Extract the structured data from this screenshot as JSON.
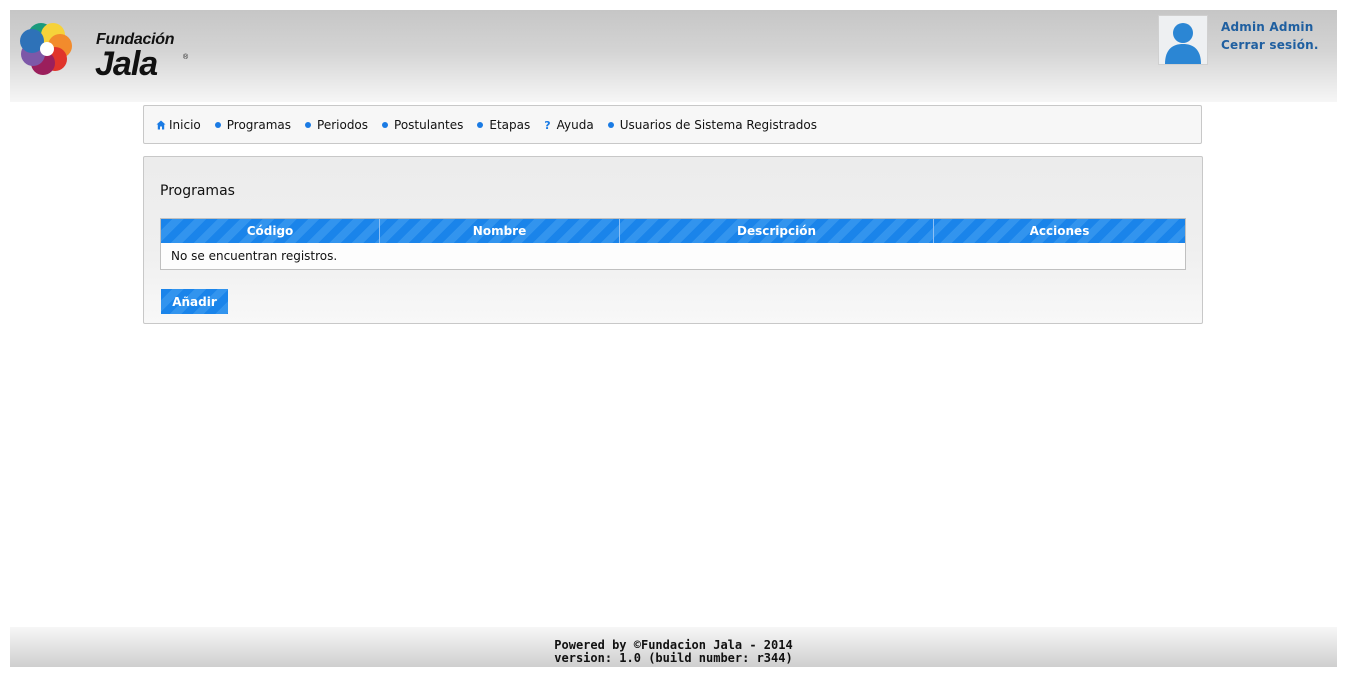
{
  "header": {
    "logo_text_top": "Fundación",
    "logo_text_main": "Jala",
    "logo_reg": "®",
    "user_name": "Admin Admin",
    "logout_label": "Cerrar sesión."
  },
  "nav": {
    "items": [
      {
        "label": "Inicio",
        "icon": "home-icon"
      },
      {
        "label": "Programas",
        "icon": "bullet-icon"
      },
      {
        "label": "Periodos",
        "icon": "bullet-icon"
      },
      {
        "label": "Postulantes",
        "icon": "bullet-icon"
      },
      {
        "label": "Etapas",
        "icon": "bullet-icon"
      },
      {
        "label": "Ayuda",
        "icon": "help-icon"
      },
      {
        "label": "Usuarios de Sistema Registrados",
        "icon": "bullet-icon"
      }
    ],
    "help_symbol": "?"
  },
  "main": {
    "title": "Programas",
    "table": {
      "columns": [
        "Código",
        "Nombre",
        "Descripción",
        "Acciones"
      ],
      "empty_message": "No se encuentran registros."
    },
    "add_button_label": "Añadir"
  },
  "footer": {
    "line1": "Powered by ©Fundacion Jala - 2014",
    "line2": "version: 1.0 (build number: r344)"
  },
  "colors": {
    "accent": "#1a84ea",
    "link": "#1f5fa0"
  }
}
